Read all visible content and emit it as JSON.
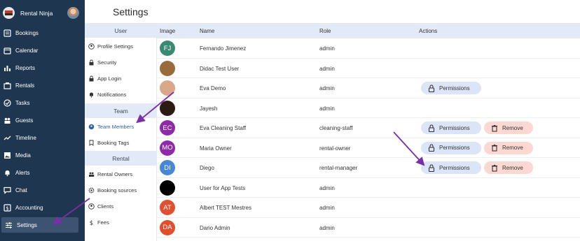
{
  "brand": {
    "name": "Rental Ninja",
    "logo_icon": "brand-logo-icon",
    "avatar_icon": "user-avatar-icon"
  },
  "nav": {
    "items": [
      {
        "label": "Bookings",
        "icon": "bookings-icon"
      },
      {
        "label": "Calendar",
        "icon": "calendar-icon"
      },
      {
        "label": "Reports",
        "icon": "bar-chart-icon"
      },
      {
        "label": "Rentals",
        "icon": "rentals-icon"
      },
      {
        "label": "Tasks",
        "icon": "check-circle-icon"
      },
      {
        "label": "Guests",
        "icon": "people-icon"
      },
      {
        "label": "Timeline",
        "icon": "trend-icon"
      },
      {
        "label": "Media",
        "icon": "image-icon"
      },
      {
        "label": "Alerts",
        "icon": "bell-icon"
      },
      {
        "label": "Chat",
        "icon": "chat-icon"
      },
      {
        "label": "Accounting",
        "icon": "dollar-icon"
      },
      {
        "label": "Settings",
        "icon": "sliders-icon",
        "active": true
      }
    ]
  },
  "page": {
    "title": "Settings"
  },
  "submenu": {
    "user_header": "User",
    "user_items": [
      "Profile Settings",
      "Security",
      "App Login",
      "Notifications"
    ],
    "team_header": "Team",
    "team_items": [
      "Team Members",
      "Booking Tags"
    ],
    "rental_header": "Rental",
    "rental_items": [
      "Rental Owners",
      "Booking sources",
      "Clients",
      "Fees"
    ]
  },
  "table": {
    "columns": {
      "image": "Image",
      "name": "Name",
      "role": "Role",
      "actions": "Actions"
    },
    "actions": {
      "permissions": "Permissions",
      "remove": "Remove"
    },
    "rows": [
      {
        "initials": "FJ",
        "avatar_color": "#3a8a73",
        "name": "Fernando Jimenez",
        "role": "admin",
        "permissions": false,
        "remove": false
      },
      {
        "initials": "",
        "avatar_color": "#9a6b3a",
        "name": "Didac Test User",
        "role": "admin",
        "permissions": false,
        "remove": false
      },
      {
        "initials": "",
        "avatar_color": "#d9a78a",
        "name": "Eva Demo",
        "role": "admin",
        "permissions": true,
        "remove": false
      },
      {
        "initials": "",
        "avatar_color": "#2d1a12",
        "name": "Jayesh",
        "role": "admin",
        "permissions": false,
        "remove": false
      },
      {
        "initials": "EC",
        "avatar_color": "#8e2aa8",
        "name": "Eva Cleaning Staff",
        "role": "cleaning-staff",
        "permissions": true,
        "remove": true
      },
      {
        "initials": "MO",
        "avatar_color": "#8e2aa8",
        "name": "Maria Owner",
        "role": "rental-owner",
        "permissions": true,
        "remove": true
      },
      {
        "initials": "DI",
        "avatar_color": "#4a86d6",
        "name": "Diego",
        "role": "rental-manager",
        "permissions": true,
        "remove": true
      },
      {
        "initials": "",
        "avatar_color": "#000000",
        "name": "User for App Tests",
        "role": "admin",
        "permissions": false,
        "remove": false
      },
      {
        "initials": "AT",
        "avatar_color": "#e0502f",
        "name": "Albert TEST Mestres",
        "role": "admin",
        "permissions": false,
        "remove": false
      },
      {
        "initials": "DA",
        "avatar_color": "#e0502f",
        "name": "Dario Admin",
        "role": "admin",
        "permissions": false,
        "remove": false
      }
    ]
  },
  "colors": {
    "sidebar": "#1f3650",
    "header_band": "#e2eaf7",
    "permissions_btn": "#dce5f7",
    "remove_btn": "#fbd9d2",
    "arrow": "#7a2fa8"
  }
}
